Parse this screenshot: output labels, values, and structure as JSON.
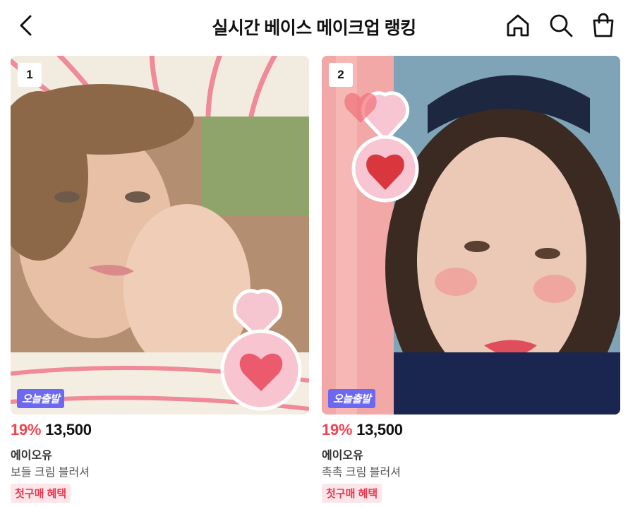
{
  "header": {
    "title": "실시간 베이스 메이크업 랭킹",
    "back_icon": "chevron-left-icon",
    "home_icon": "home-icon",
    "search_icon": "search-icon",
    "cart_icon": "shopping-bag-icon"
  },
  "products": [
    {
      "rank": "1",
      "delivery_badge": "오늘출발",
      "discount": "19%",
      "price": "13,500",
      "brand": "에이오유",
      "name": "보들 크림 블러셔",
      "benefit": "첫구매 혜택"
    },
    {
      "rank": "2",
      "delivery_badge": "오늘출발",
      "discount": "19%",
      "price": "13,500",
      "brand": "에이오유",
      "name": "촉촉 크림 블러셔",
      "benefit": "첫구매 혜택"
    }
  ],
  "colors": {
    "discount": "#ef4452",
    "delivery_badge_bg": "#6d68f0",
    "benefit_bg": "#fde6ea",
    "benefit_text": "#e8384f"
  }
}
